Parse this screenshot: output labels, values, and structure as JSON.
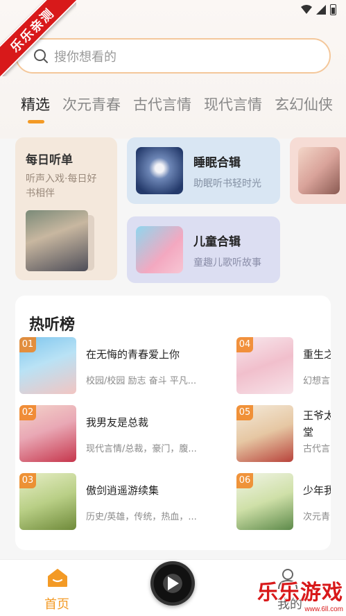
{
  "watermark": {
    "ribbon": "乐乐亲测",
    "site_name": "乐乐游戏",
    "site_url": "www.6ll.com"
  },
  "search": {
    "placeholder": "搜你想看的"
  },
  "tabs": [
    {
      "label": "精选",
      "active": true
    },
    {
      "label": "次元青春"
    },
    {
      "label": "古代言情"
    },
    {
      "label": "现代言情"
    },
    {
      "label": "玄幻仙侠"
    }
  ],
  "cards": {
    "daily": {
      "title": "每日听单",
      "subtitle": "听声入戏·每日好书相伴"
    },
    "sleep": {
      "title": "睡眠合辑",
      "subtitle": "助眠听书轻时光"
    },
    "child": {
      "title": "儿童合辑",
      "subtitle": "童趣儿歌听故事"
    }
  },
  "hot_list": {
    "title": "热听榜",
    "items": [
      {
        "rank": "01",
        "title": "在无悔的青春爱上你",
        "tags": "校园/校园 励志 奋斗 平凡..."
      },
      {
        "rank": "02",
        "title": "我男友是总裁",
        "tags": "现代言情/总裁，豪门，腹..."
      },
      {
        "rank": "03",
        "title": "傲剑逍遥游续集",
        "tags": "历史/英雄，传统，热血，..."
      },
      {
        "rank": "04",
        "title": "重生之",
        "tags": "幻想言"
      },
      {
        "rank": "05",
        "title": "王爷太",
        "title2": "堂",
        "tags": "古代言"
      },
      {
        "rank": "06",
        "title": "少年我",
        "tags": "次元青"
      }
    ]
  },
  "nav": {
    "home": "首页",
    "mine": "我的"
  },
  "colors": {
    "accent": "#f39a25",
    "search_border": "#f4c79a",
    "rank_badge": "#f0821e"
  }
}
